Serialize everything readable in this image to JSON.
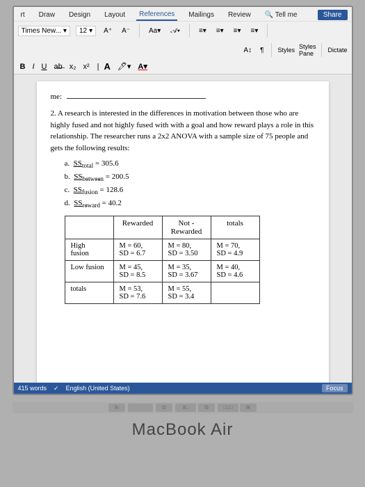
{
  "ribbon": {
    "tabs": [
      "rt",
      "Draw",
      "Design",
      "Layout",
      "References",
      "Mailings",
      "Review",
      "Tell me",
      "Share"
    ],
    "active_tab": "References",
    "font_name": "Times New...",
    "font_size": "12",
    "share_label": "Share",
    "formatting_buttons": [
      "B",
      "I",
      "U",
      "ab",
      "x₂",
      "x²"
    ],
    "styles_label": "Styles",
    "styles_pane_label": "Styles\nPane",
    "dictate_label": "Dictate"
  },
  "document": {
    "name_label": "me:",
    "question_number": "2.",
    "question_text": "A research is interested in the differences in motivation between those who are highly fused and not highly fused with with a goal and how reward plays a role in this relationship. The researcher runs a 2x2 ANOVA with a sample size of 75 people and gets the following results:",
    "sub_items": [
      {
        "label": "a.",
        "text": "SS",
        "subscript": "total",
        "value": "= 305.6"
      },
      {
        "label": "b.",
        "text": "SS",
        "subscript": "between",
        "value": "= 200.5"
      },
      {
        "label": "c.",
        "text": "SS",
        "subscript": "fusion",
        "value": "= 128.6"
      },
      {
        "label": "d.",
        "text": "SS",
        "subscript": "reward",
        "value": "= 40.2"
      }
    ],
    "table": {
      "headers": [
        "Rewarded",
        "Not -\nRewarded",
        "totals"
      ],
      "rows": [
        {
          "label": "High\nfusion",
          "rewarded": "M = 60,\nSD = 6.7",
          "not_rewarded": "M = 80,\nSD = 3.50",
          "totals": "M = 70,\nSD = 4.9"
        },
        {
          "label": "Low fusion",
          "rewarded": "M = 45,\nSD = 8.5",
          "not_rewarded": "M = 35,\nSD = 3.67",
          "totals": "M = 40,\nSD = 4.6"
        },
        {
          "label": "totals",
          "rewarded": "M = 53,\nSD = 7.6",
          "not_rewarded": "M = 55,\nSD = 3.4",
          "totals": ""
        }
      ]
    }
  },
  "status_bar": {
    "words": "415 words",
    "language": "English (United States)",
    "focus_label": "Focus"
  },
  "laptop": {
    "brand": "MacBook Air"
  }
}
